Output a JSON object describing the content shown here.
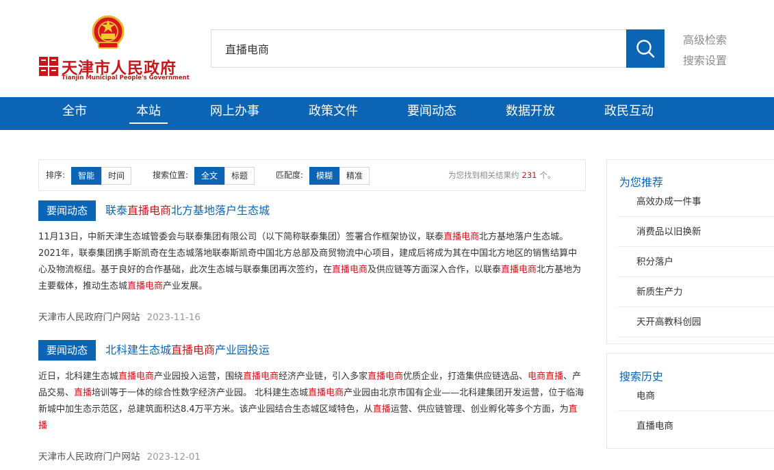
{
  "header": {
    "logo_cn": "天津市人民政府",
    "logo_en": "Tianjin Municipal People's Government",
    "search_value": "直播电商",
    "links": [
      "高级检索",
      "搜索设置"
    ]
  },
  "nav": {
    "items": [
      "全市",
      "本站",
      "网上办事",
      "政策文件",
      "要闻动态",
      "数据开放",
      "政民互动"
    ],
    "active": "本站"
  },
  "filters": {
    "sort_label": "排序:",
    "sort_options": [
      "智能",
      "时间"
    ],
    "scope_label": "搜索位置:",
    "scope_options": [
      "全文",
      "标题"
    ],
    "match_label": "匹配度:",
    "match_options": [
      "模糊",
      "精准"
    ],
    "count_prefix": "为您找到相关结果约",
    "count": "231",
    "count_suffix": "个。"
  },
  "results": [
    {
      "tag": "要闻动态",
      "title": [
        [
          "联泰",
          false
        ],
        [
          "直播电商",
          true
        ],
        [
          "北方基地落户生态城",
          false
        ]
      ],
      "body": [
        [
          "11月13日，中新天津生态城管委会与联泰集团有限公司（以下简称联泰集团）签署合作框架协议，联泰",
          false
        ],
        [
          "直播电商",
          true
        ],
        [
          "北方基地落户生态城。 2021年，联泰集团携手斯凯奇在生态城落地联泰斯凯奇中国北方总部及商贸物流中心项目，建成后将成为其在中国北方地区的销售结算中心及物流枢纽。基于良好的合作基础，此次生态城与联泰集团再次签约，在",
          false
        ],
        [
          "直播电商",
          true
        ],
        [
          "及供应链等方面深入合作，以联泰",
          false
        ],
        [
          "直播电商",
          true
        ],
        [
          "北方基地为主要载体，推动生态城",
          false
        ],
        [
          "直播电商",
          true
        ],
        [
          "产业发展。",
          false
        ]
      ],
      "source": "天津市人民政府门户网站",
      "date": "2023-11-16"
    },
    {
      "tag": "要闻动态",
      "title": [
        [
          "北科建生态城",
          false
        ],
        [
          "直播电商",
          true
        ],
        [
          "产业园投运",
          false
        ]
      ],
      "body": [
        [
          "近日，北科建生态城",
          false
        ],
        [
          "直播电商",
          true
        ],
        [
          "产业园投入运营，围绕",
          false
        ],
        [
          "直播电商",
          true
        ],
        [
          "经济产业链，引入多家",
          false
        ],
        [
          "直播电商",
          true
        ],
        [
          "优质企业，打造集供应链选品、",
          false
        ],
        [
          "电商直播",
          true
        ],
        [
          "、产品交易、",
          false
        ],
        [
          "直播",
          true
        ],
        [
          "培训等于一体的综合性数字经济产业园。 北科建生态城",
          false
        ],
        [
          "直播电商",
          true
        ],
        [
          "产业园由北京市国有企业——北科建集团开发运营，位于临海新城中加生态示范区，总建筑面积达8.4万平方米。该产业园结合生态城区域特色，从",
          false
        ],
        [
          "直播",
          true
        ],
        [
          "运营、供应链管理、创业孵化等多个方面，为",
          false
        ],
        [
          "直播",
          true
        ]
      ],
      "source": "天津市人民政府门户网站",
      "date": "2023-12-01"
    }
  ],
  "sidebar": {
    "recommend_title": "为您推荐",
    "recommend_items": [
      "高效办成一件事",
      "消费品以旧换新",
      "积分落户",
      "新质生产力",
      "天开高教科创园"
    ],
    "history_title": "搜索历史",
    "history_items": [
      "电商",
      "直播电商"
    ]
  },
  "colors": {
    "brand_blue": "#0b65b4",
    "highlight_red": "#c8161d"
  },
  "icons": [
    "national-emblem-icon",
    "search-icon"
  ]
}
